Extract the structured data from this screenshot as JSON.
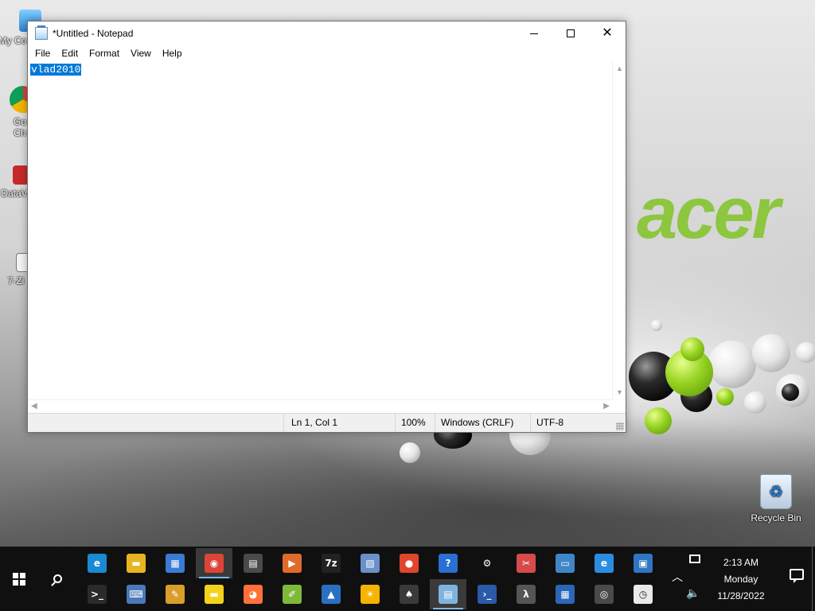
{
  "desktop": {
    "wallpaper_brand": "acer",
    "icons": [
      {
        "label": "My Co",
        "icon": "computer-icon"
      },
      {
        "label": "Go\nCh",
        "icon": "chrome-icon"
      },
      {
        "label": "DataV",
        "icon": "datav-icon"
      },
      {
        "label": "7-Zi",
        "icon": "7zip-icon"
      }
    ],
    "recycle_bin": {
      "label": "Recycle Bin",
      "icon": "recycle-bin-icon"
    }
  },
  "notepad": {
    "title": "*Untitled - Notepad",
    "menu": [
      "File",
      "Edit",
      "Format",
      "View",
      "Help"
    ],
    "content": "vlad2010",
    "selection_color": "#0078d7",
    "status": {
      "position": "Ln 1, Col 1",
      "zoom": "100%",
      "line_endings": "Windows (CRLF)",
      "encoding": "UTF-8"
    }
  },
  "taskbar": {
    "background": "#101010",
    "icons_row1": [
      {
        "name": "edge-icon",
        "glyph": "e",
        "color": "#1a8ad4"
      },
      {
        "name": "file-explorer-icon",
        "glyph": "▬",
        "color": "#e8b422"
      },
      {
        "name": "store-icon",
        "glyph": "▦",
        "color": "#3a7bd5"
      },
      {
        "name": "chrome-icon",
        "glyph": "◉",
        "color": "#db4437"
      },
      {
        "name": "calculator-icon",
        "glyph": "▤",
        "color": "#4a4a4a"
      },
      {
        "name": "media-player-icon",
        "glyph": "▶",
        "color": "#e06a2a"
      },
      {
        "name": "7zip-icon",
        "glyph": "7z",
        "color": "#222222"
      },
      {
        "name": "wordpad-icon",
        "glyph": "▧",
        "color": "#6b8fc9"
      },
      {
        "name": "maps-icon",
        "glyph": "●",
        "color": "#e0462c"
      },
      {
        "name": "help-icon",
        "glyph": "?",
        "color": "#2a6fd1"
      },
      {
        "name": "settings-icon",
        "glyph": "⚙",
        "color": "#101010"
      },
      {
        "name": "snipping-tool-icon",
        "glyph": "✂",
        "color": "#d64a4a"
      },
      {
        "name": "remote-desktop-icon",
        "glyph": "▭",
        "color": "#3f86c9"
      },
      {
        "name": "internet-explorer-icon",
        "glyph": "e",
        "color": "#2a8ee0"
      },
      {
        "name": "system-info-icon",
        "glyph": "▣",
        "color": "#2f76c2"
      }
    ],
    "icons_row2": [
      {
        "name": "cmd-icon",
        "glyph": ">_",
        "color": "#2b2b2b"
      },
      {
        "name": "keyboard-icon",
        "glyph": "⌨",
        "color": "#4b78b8"
      },
      {
        "name": "paint-icon",
        "glyph": "✎",
        "color": "#d99d2a"
      },
      {
        "name": "sticky-notes-icon",
        "glyph": "▬",
        "color": "#f4d21c"
      },
      {
        "name": "firefox-icon",
        "glyph": "◕",
        "color": "#ff7139"
      },
      {
        "name": "notepadpp-icon",
        "glyph": "✐",
        "color": "#7fb93a"
      },
      {
        "name": "photos-icon",
        "glyph": "▲",
        "color": "#2a70c2"
      },
      {
        "name": "weather-icon",
        "glyph": "☀",
        "color": "#f5b400"
      },
      {
        "name": "solitaire-icon",
        "glyph": "♠",
        "color": "#3a3a3a"
      },
      {
        "name": "notepad-icon",
        "glyph": "▤",
        "color": "#7fb3de"
      },
      {
        "name": "powershell-icon",
        "glyph": "›_",
        "color": "#2a5aa8"
      },
      {
        "name": "wsl-icon",
        "glyph": "λ",
        "color": "#555555"
      },
      {
        "name": "network-icon",
        "glyph": "▦",
        "color": "#2a66b8"
      },
      {
        "name": "camera-icon",
        "glyph": "◎",
        "color": "#4a4a4a"
      },
      {
        "name": "clock-icon",
        "glyph": "◷",
        "color": "#e9e9e9"
      }
    ],
    "clock": {
      "time": "2:13 AM",
      "day": "Monday",
      "date": "11/28/2022"
    }
  }
}
